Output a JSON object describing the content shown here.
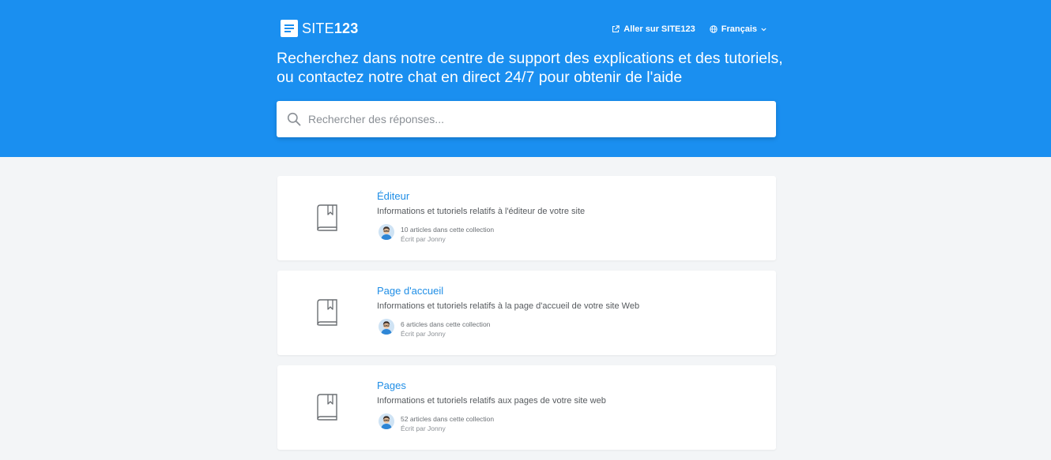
{
  "header": {
    "logo": {
      "text_site": "SITE",
      "text_num": "123"
    },
    "nav": {
      "go_to_site_label": "Aller sur SITE123",
      "language_label": "Français"
    },
    "headline_line1": "Recherchez dans notre centre de support des explications et des tutoriels,",
    "headline_line2": "ou contactez notre chat en direct 24/7 pour obtenir de l'aide"
  },
  "search": {
    "placeholder": "Rechercher des réponses...",
    "value": ""
  },
  "collections": [
    {
      "title": "Éditeur",
      "description": "Informations et tutoriels relatifs à l'éditeur de votre site",
      "count_text": "10 articles dans cette collection",
      "author_text": "Écrit par Jonny"
    },
    {
      "title": "Page d'accueil",
      "description": "Informations et tutoriels relatifs à la page d'accueil de votre site Web",
      "count_text": "6 articles dans cette collection",
      "author_text": "Écrit par Jonny"
    },
    {
      "title": "Pages",
      "description": "Informations et tutoriels relatifs aux pages de votre site web",
      "count_text": "52 articles dans cette collection",
      "author_text": "Écrit par Jonny"
    }
  ],
  "colors": {
    "header_bg": "#1a8ff0",
    "page_bg": "#f3f5f7",
    "link": "#1f8ee6"
  },
  "icons": {
    "logo": "site123-logo-icon",
    "external_link": "external-link-icon",
    "globe": "globe-icon",
    "chevron": "chevron-down-icon",
    "search": "search-icon",
    "collection": "book-icon",
    "author": "avatar"
  }
}
